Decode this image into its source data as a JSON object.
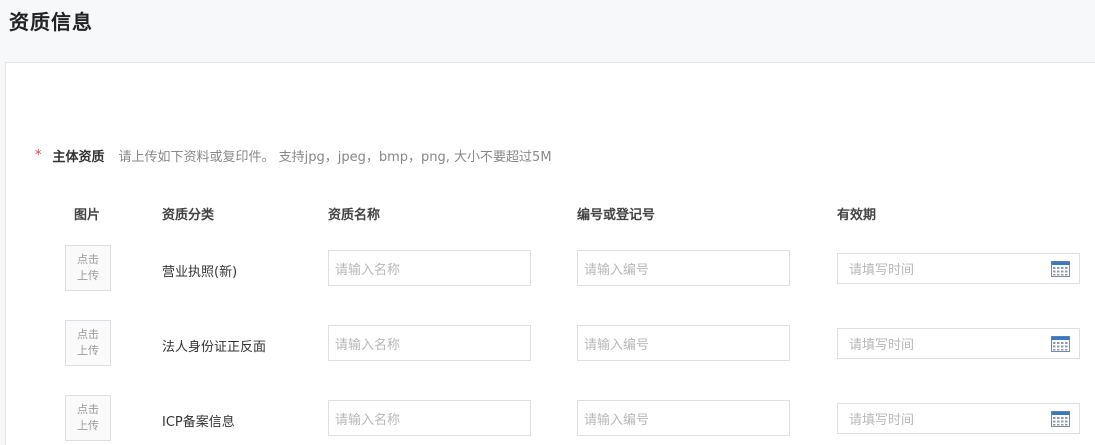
{
  "page": {
    "title": "资质信息"
  },
  "section": {
    "required_mark": "*",
    "label": "主体资质",
    "hint": "请上传如下资料或复印件。 支持jpg，jpeg，bmp，png, 大小不要超过5M"
  },
  "table": {
    "headers": {
      "image": "图片",
      "category": "资质分类",
      "name": "资质名称",
      "number": "编号或登记号",
      "validity": "有效期"
    },
    "upload_line1": "点击",
    "upload_line2": "上传",
    "name_placeholder": "请输入名称",
    "number_placeholder": "请输入编号",
    "date_placeholder": "请填写时间",
    "rows": [
      {
        "category": "营业执照(新)"
      },
      {
        "category": "法人身份证正反面"
      },
      {
        "category": "ICP备案信息"
      }
    ]
  },
  "colors": {
    "required": "#e4393c",
    "calendar_accent": "#3a78c4"
  },
  "icons": {
    "date": "calendar-icon"
  }
}
